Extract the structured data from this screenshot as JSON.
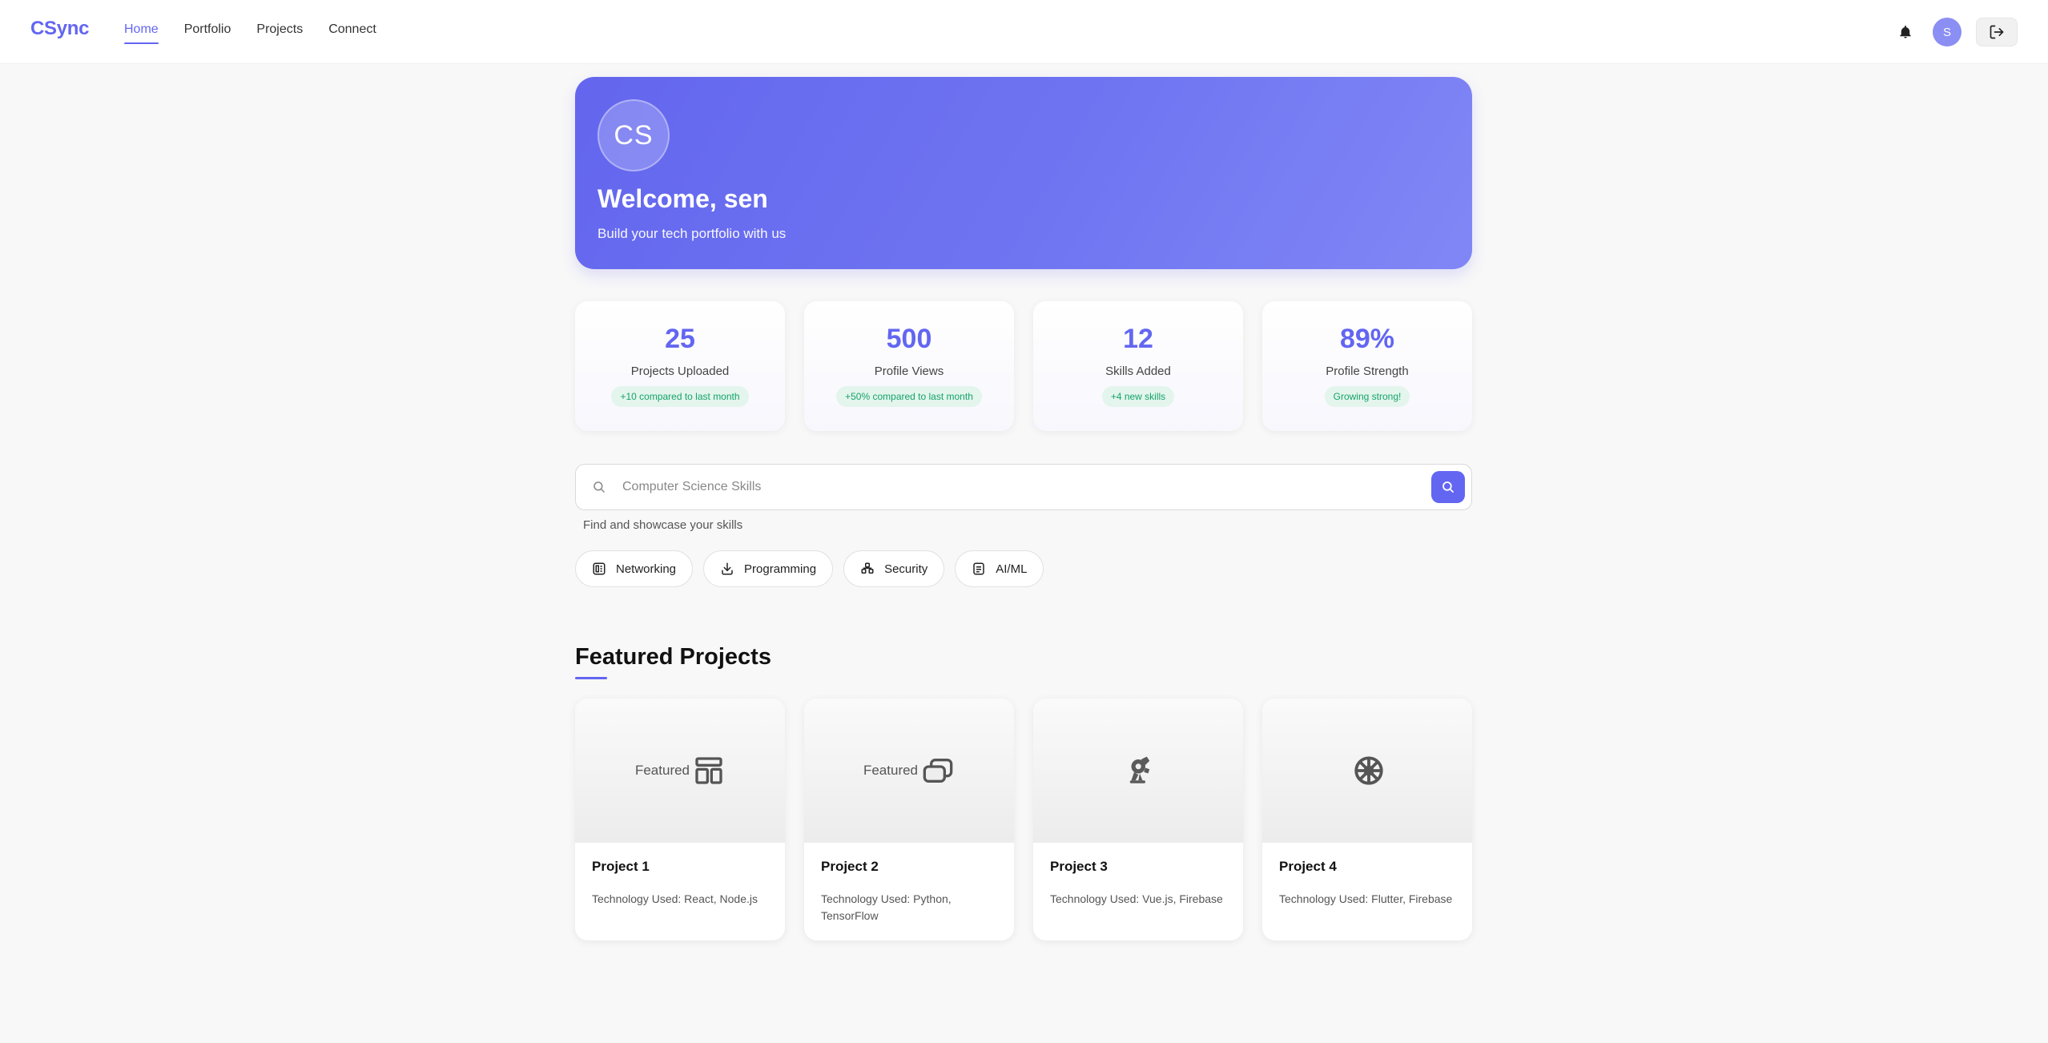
{
  "nav": {
    "brand": "CSync",
    "links": [
      {
        "label": "Home",
        "active": true
      },
      {
        "label": "Portfolio",
        "active": false
      },
      {
        "label": "Projects",
        "active": false
      },
      {
        "label": "Connect",
        "active": false
      }
    ],
    "avatar_initial": "S",
    "icons": [
      "bell-icon",
      "logout-icon"
    ]
  },
  "hero": {
    "avatar_initials": "CS",
    "title": "Welcome, sen",
    "subtitle": "Build your tech portfolio with us"
  },
  "stats": [
    {
      "value": "25",
      "label": "Projects Uploaded",
      "badge": "+10 compared to last month"
    },
    {
      "value": "500",
      "label": "Profile Views",
      "badge": "+50% compared to last month"
    },
    {
      "value": "12",
      "label": "Skills Added",
      "badge": "+4 new skills"
    },
    {
      "value": "89%",
      "label": "Profile Strength",
      "badge": "Growing strong!"
    }
  ],
  "search": {
    "placeholder": "Computer Science Skills",
    "hint": "Find and showcase your skills"
  },
  "chips": [
    {
      "label": "Networking",
      "icon": "network-icon"
    },
    {
      "label": "Programming",
      "icon": "download-icon"
    },
    {
      "label": "Security",
      "icon": "security-icon"
    },
    {
      "label": "AI/ML",
      "icon": "document-icon"
    }
  ],
  "featured": {
    "title": "Featured Projects",
    "projects": [
      {
        "thumb_text": "Featured",
        "thumb_icon": "layout-icon",
        "name": "Project 1",
        "tech": "Technology Used: React, Node.js"
      },
      {
        "thumb_text": "Featured",
        "thumb_icon": "windows-icon",
        "name": "Project 2",
        "tech": "Technology Used: Python, TensorFlow"
      },
      {
        "thumb_text": "",
        "thumb_icon": "robot-arm-icon",
        "name": "Project 3",
        "tech": "Technology Used: Vue.js, Firebase"
      },
      {
        "thumb_text": "",
        "thumb_icon": "dharma-wheel-icon",
        "name": "Project 4",
        "tech": "Technology Used: Flutter, Firebase"
      }
    ]
  },
  "colors": {
    "accent": "#6366f1",
    "badge_text": "#16a36b",
    "badge_bg": "#e3f5ec"
  }
}
